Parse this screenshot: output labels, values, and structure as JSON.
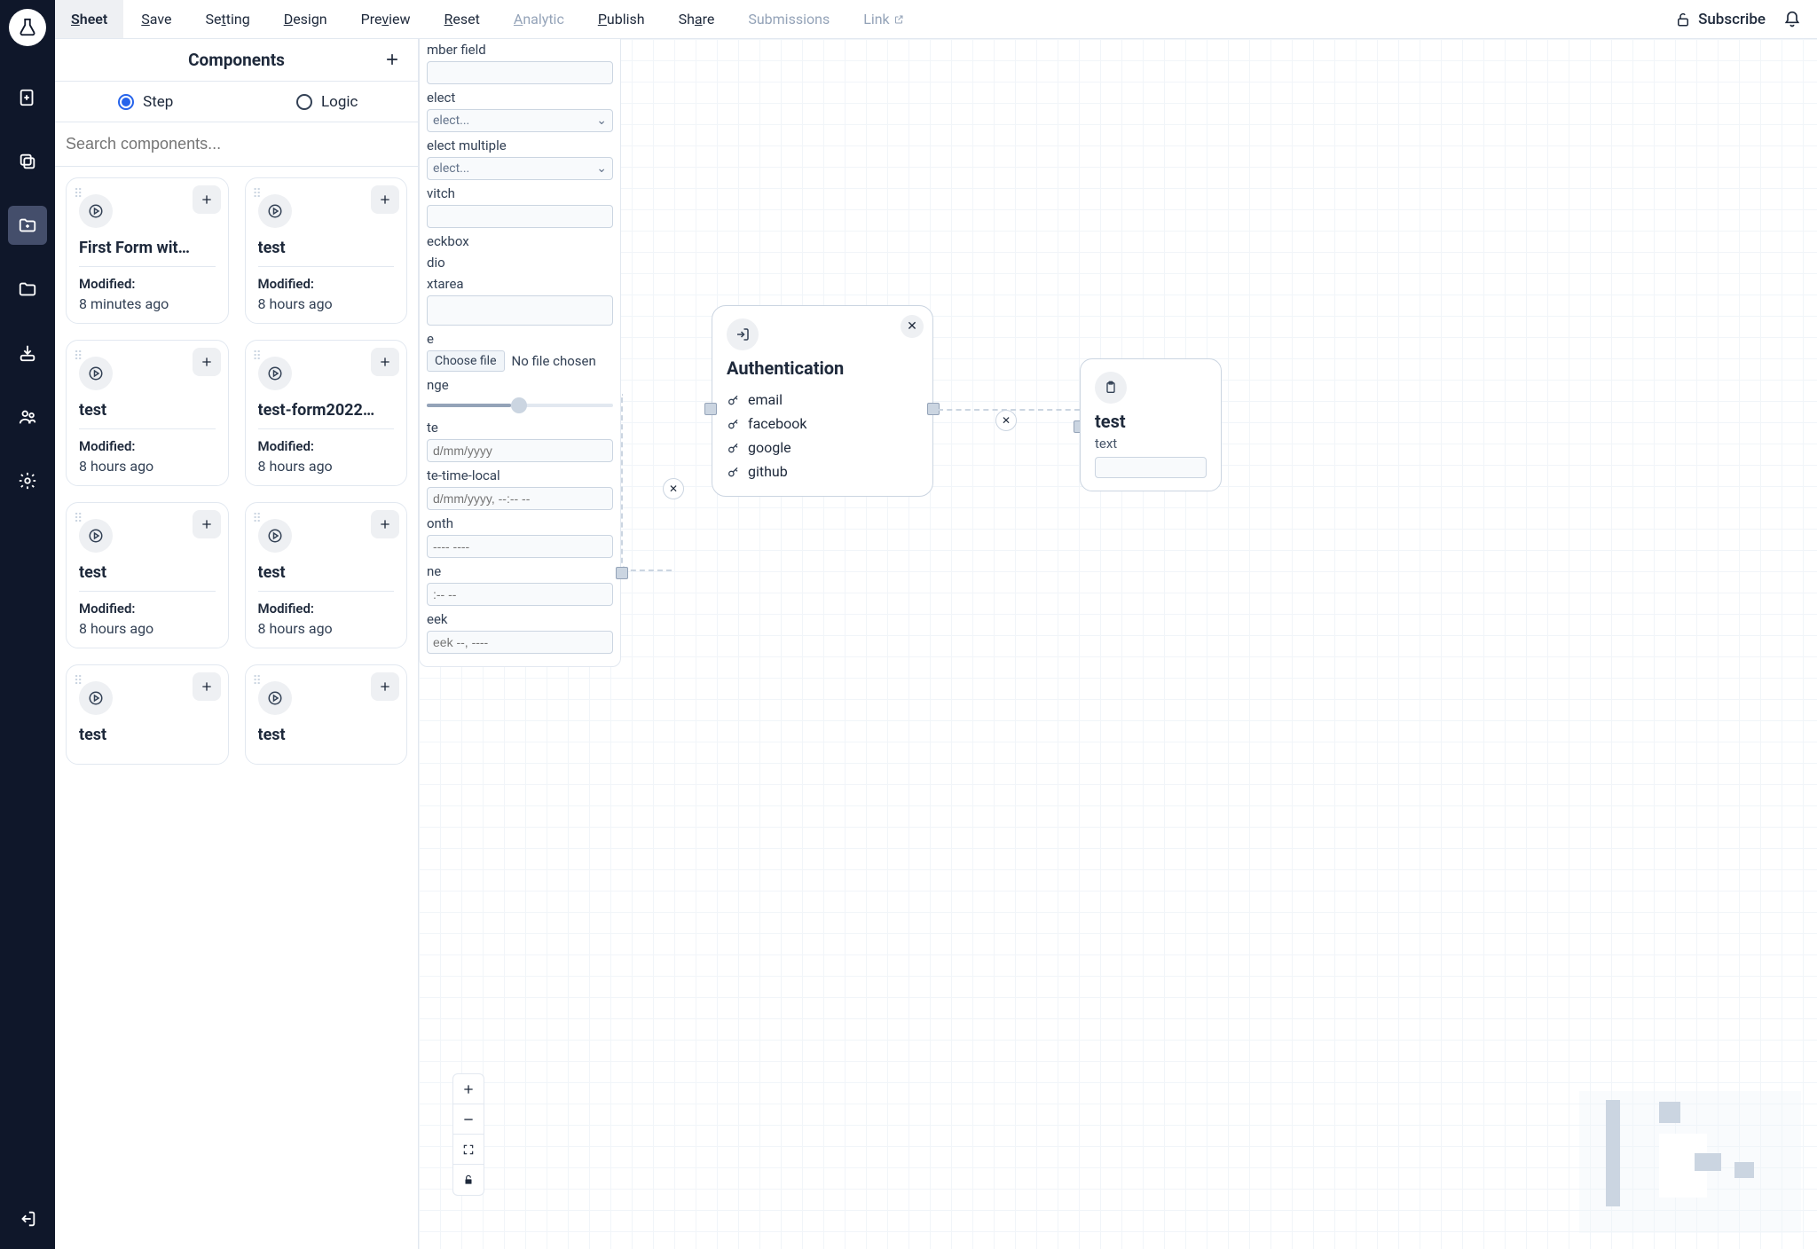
{
  "topmenu": {
    "sheet": "Sheet",
    "save": "Save",
    "setting": "Setting",
    "design": "Design",
    "preview": "Preview",
    "reset": "Reset",
    "analytic": "Analytic",
    "publish": "Publish",
    "share": "Share",
    "submissions": "Submissions",
    "link": "Link",
    "subscribe": "Subscribe"
  },
  "side": {
    "title": "Components",
    "tab_step": "Step",
    "tab_logic": "Logic",
    "search_placeholder": "Search components...",
    "modified_label": "Modified:",
    "cards": [
      {
        "title": "First Form wit…",
        "time": "8 minutes ago"
      },
      {
        "title": "test",
        "time": "8 hours ago"
      },
      {
        "title": "test",
        "time": "8 hours ago"
      },
      {
        "title": "test-form2022…",
        "time": "8 hours ago"
      },
      {
        "title": "test",
        "time": "8 hours ago"
      },
      {
        "title": "test",
        "time": "8 hours ago"
      },
      {
        "title": "test",
        "time": ""
      },
      {
        "title": "test",
        "time": ""
      }
    ]
  },
  "form_panel": {
    "number_field": "mber field",
    "select": "elect",
    "select_ph": "elect...",
    "select_multiple": "elect multiple",
    "switch": "vitch",
    "checkbox": "eckbox",
    "radio": "dio",
    "textarea": "xtarea",
    "file": "e",
    "choose_file": "Choose file",
    "no_file": "No file chosen",
    "range": "nge",
    "date": "te",
    "date_ph": "d/mm/yyyy",
    "datetime": "te-time-local",
    "datetime_ph": "d/mm/yyyy, --:-- --",
    "month": "onth",
    "month_ph": "---- ----",
    "time": "ne",
    "time_ph": ":-- --",
    "week": "eek",
    "week_ph": "eek --, ----"
  },
  "auth_node": {
    "title": "Authentication",
    "opts": [
      "email",
      "facebook",
      "google",
      "github"
    ]
  },
  "test_node": {
    "title": "test",
    "sub": "text"
  }
}
